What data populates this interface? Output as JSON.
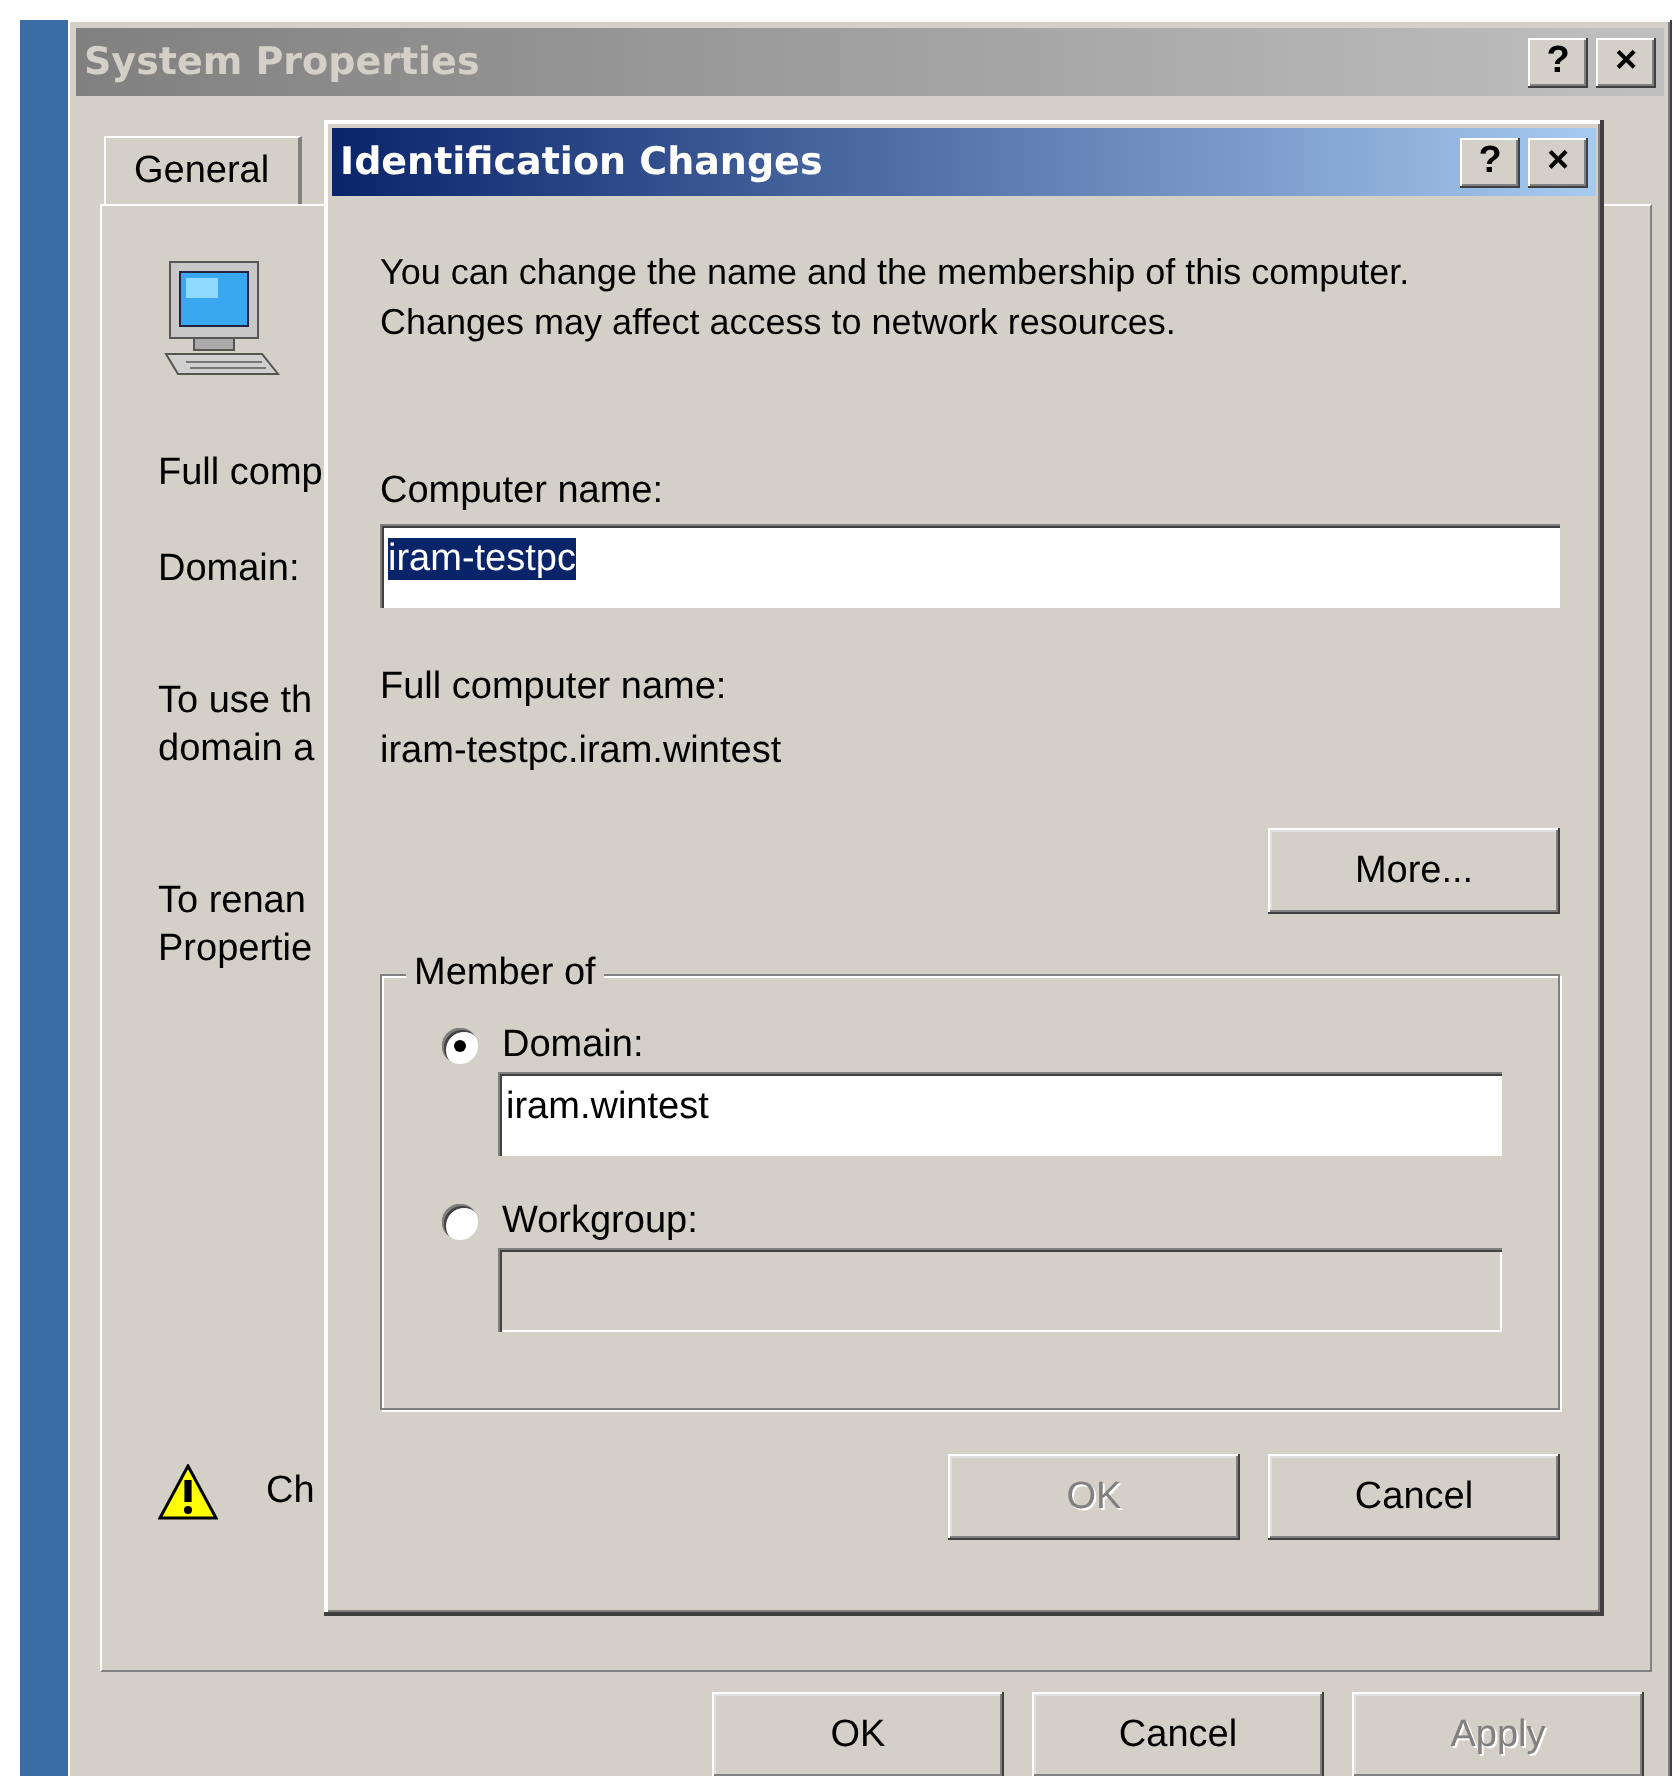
{
  "background_window": {
    "title": "System Properties",
    "title_buttons": [
      "?",
      "×"
    ],
    "tabs": [
      {
        "label": "General",
        "selected": true
      }
    ],
    "lines": [
      {
        "kind": "single",
        "texts": [
          "Full comp"
        ]
      },
      {
        "kind": "single",
        "texts": [
          "Domain:"
        ]
      },
      {
        "kind": "double",
        "texts": [
          "To use th",
          "domain a"
        ]
      },
      {
        "kind": "double",
        "texts": [
          "To renan",
          "Propertie"
        ]
      }
    ],
    "warning_text": "Ch",
    "buttons": [
      {
        "label": "OK",
        "disabled": false
      },
      {
        "label": "Cancel",
        "disabled": false
      },
      {
        "label": "Apply",
        "disabled": true
      }
    ]
  },
  "dialog": {
    "title": "Identification Changes",
    "title_buttons": [
      "?",
      "×"
    ],
    "description": "You can change the name and the membership of this computer. Changes may affect access to network resources.",
    "computer_name_label": "Computer name:",
    "computer_name": {
      "value": "iram-testpc",
      "selected": true
    },
    "full_name_label": "Full computer name:",
    "full_name": "iram-testpc.iram.wintest",
    "more_button": "More...",
    "member_of": {
      "label": "Member of",
      "options": [
        {
          "label": "Domain:",
          "selected": true,
          "field": {
            "value": "iram.wintest",
            "disabled": false
          }
        },
        {
          "label": "Workgroup:",
          "selected": false,
          "field": {
            "disabled": true
          }
        }
      ]
    },
    "buttons": [
      {
        "label": "OK",
        "disabled": true
      },
      {
        "label": "Cancel",
        "disabled": false
      }
    ]
  }
}
